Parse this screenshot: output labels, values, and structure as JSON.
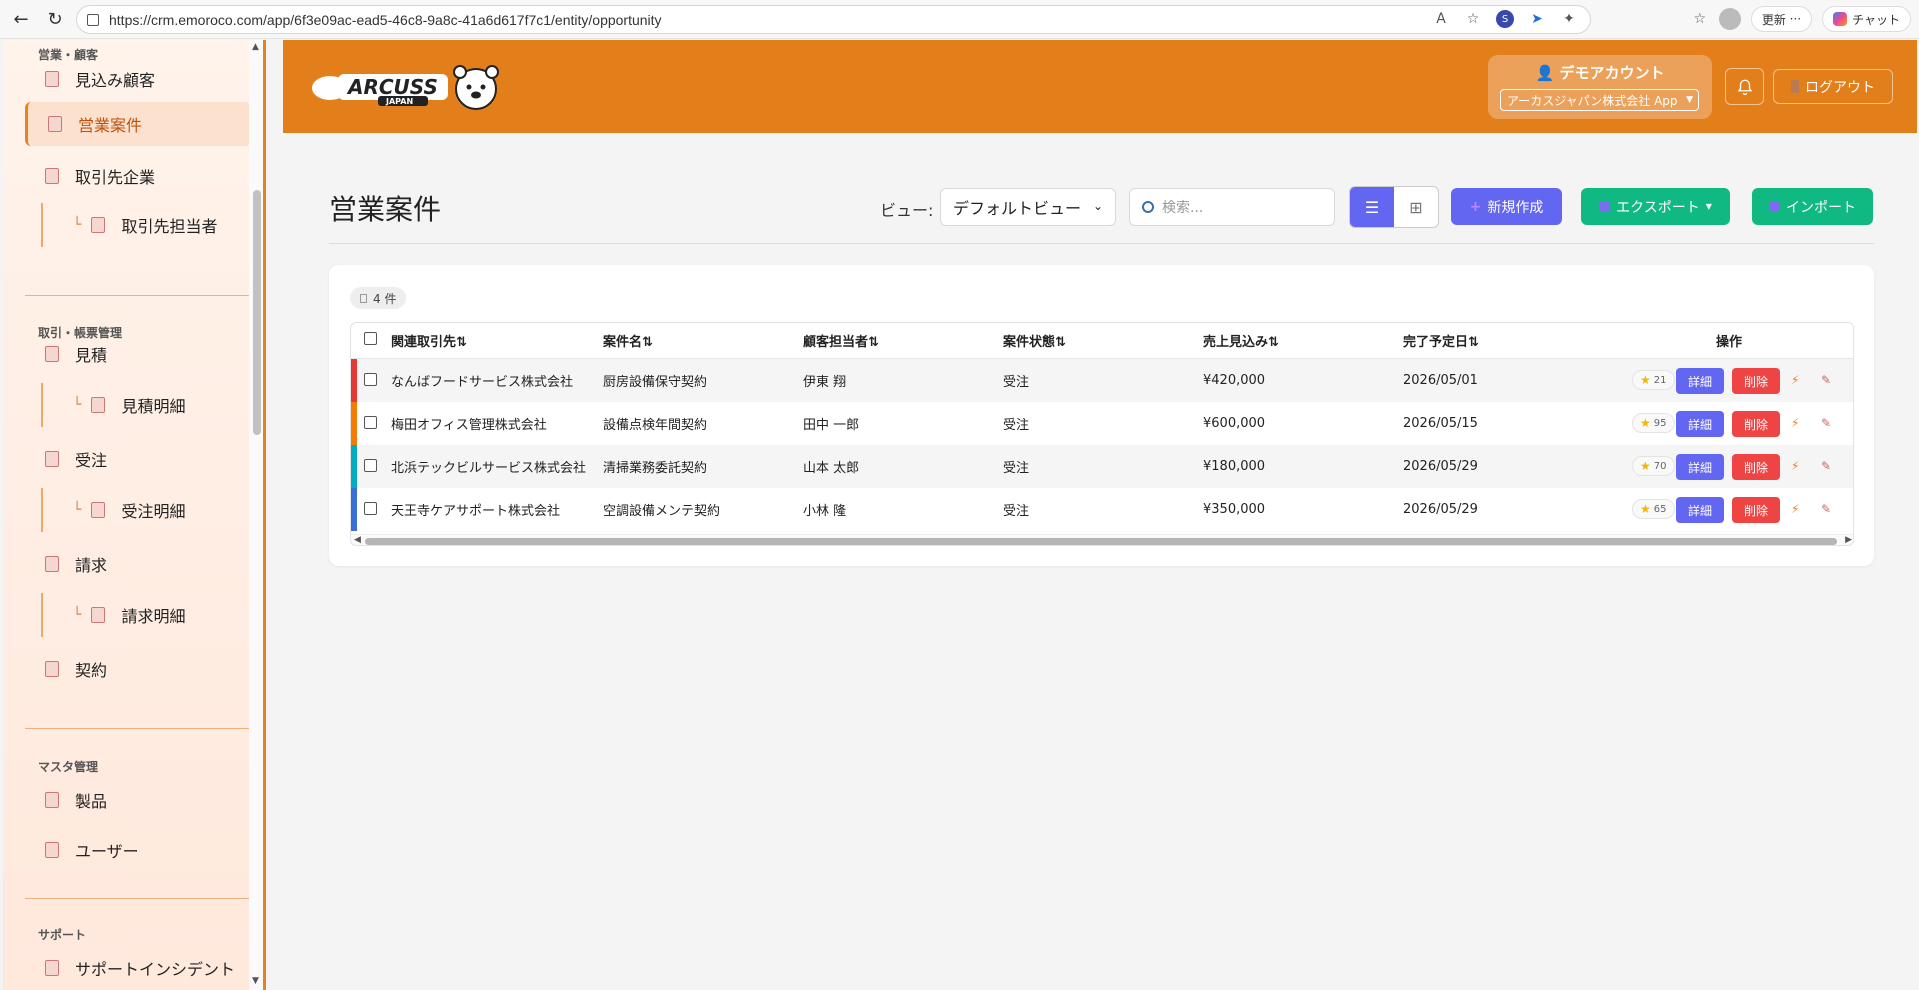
{
  "browser": {
    "url": "https://crm.emoroco.com/app/6f3e09ac-ead5-46c8-9a8c-41a6d617f7c1/entity/opportunity",
    "update_label": "更新",
    "chat_label": "チャット"
  },
  "sidebar": {
    "sections": {
      "sales": "営業・顧客",
      "trade": "取引・帳票管理",
      "master": "マスタ管理",
      "support": "サポート"
    },
    "items": {
      "leads": "見込み顧客",
      "opportunities": "営業案件",
      "accounts": "取引先企業",
      "contacts": "取引先担当者",
      "quotes": "見積",
      "quote_details": "見積明細",
      "orders": "受注",
      "order_details": "受注明細",
      "invoices": "請求",
      "invoice_details": "請求明細",
      "contracts": "契約",
      "products": "製品",
      "users": "ユーザー",
      "incidents": "サポートインシデント"
    }
  },
  "header": {
    "logo_text": "ARCUSS",
    "logo_sub": "JAPAN",
    "account_name": "デモアカウント",
    "tenant_select": "アーカスジャパン株式会社 App",
    "logout_label": "ログアウト",
    "brand_color": "#e37f1b"
  },
  "main": {
    "title": "営業案件",
    "view_label": "ビュー:",
    "view_value": "デフォルトビュー",
    "search_placeholder": "検索...",
    "new_label": "新規作成",
    "export_label": "エクスポート",
    "import_label": "インポート",
    "count_label": "4 件"
  },
  "table": {
    "headers": [
      "関連取引先⇅",
      "案件名⇅",
      "顧客担当者⇅",
      "案件状態⇅",
      "売上見込み⇅",
      "完了予定日⇅",
      "操作"
    ],
    "detail_label": "詳細",
    "delete_label": "削除",
    "rows": [
      {
        "account": "なんばフードサービス株式会社",
        "name": "厨房設備保守契約",
        "contact": "伊東 翔",
        "status": "受注",
        "amount": "¥420,000",
        "date": "2026/05/01",
        "score": "21",
        "color": "#e53935"
      },
      {
        "account": "梅田オフィス管理株式会社",
        "name": "設備点検年間契約",
        "contact": "田中 一郎",
        "status": "受注",
        "amount": "¥600,000",
        "date": "2026/05/15",
        "score": "95",
        "color": "#f57c00"
      },
      {
        "account": "北浜テックビルサービス株式会社",
        "name": "清掃業務委託契約",
        "contact": "山本 太郎",
        "status": "受注",
        "amount": "¥180,000",
        "date": "2026/05/29",
        "score": "70",
        "color": "#00acc1"
      },
      {
        "account": "天王寺ケアサポート株式会社",
        "name": "空調設備メンテ契約",
        "contact": "小林 隆",
        "status": "受注",
        "amount": "¥350,000",
        "date": "2026/05/29",
        "score": "65",
        "color": "#3b6fd8"
      }
    ]
  }
}
